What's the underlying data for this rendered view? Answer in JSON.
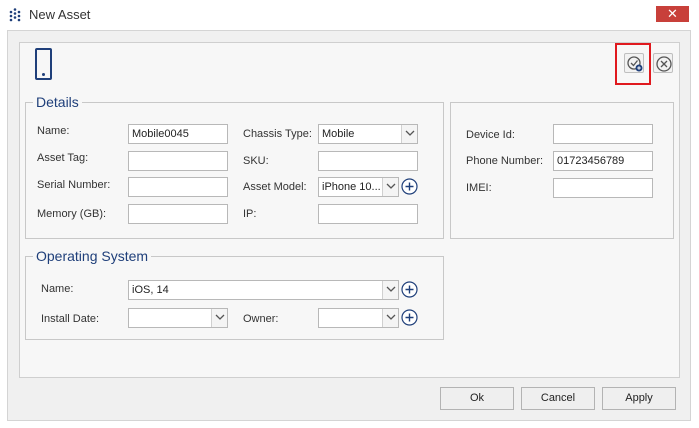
{
  "window": {
    "title": "New Asset",
    "close_glyph": "✕"
  },
  "toolbar": {
    "device_icon": "mobile-phone-icon",
    "save_icon": "save-check-icon",
    "cancel_icon": "close-circle-icon"
  },
  "details": {
    "title": "Details",
    "name": {
      "label": "Name:",
      "value": "Mobile0045"
    },
    "asset_tag": {
      "label": "Asset Tag:",
      "value": ""
    },
    "serial_number": {
      "label": "Serial Number:",
      "value": ""
    },
    "memory": {
      "label": "Memory (GB):",
      "value": ""
    },
    "chassis_type": {
      "label": "Chassis Type:",
      "value": "Mobile"
    },
    "sku": {
      "label": "SKU:",
      "value": ""
    },
    "asset_model": {
      "label": "Asset Model:",
      "value": "iPhone 10..."
    },
    "ip": {
      "label": "IP:",
      "value": ""
    }
  },
  "device": {
    "device_id": {
      "label": "Device Id:",
      "value": ""
    },
    "phone_number": {
      "label": "Phone Number:",
      "value": "01723456789"
    },
    "imei": {
      "label": "IMEI:",
      "value": ""
    }
  },
  "os": {
    "title": "Operating System",
    "name": {
      "label": "Name:",
      "value": "iOS, 14"
    },
    "install_date": {
      "label": "Install Date:",
      "value": ""
    },
    "owner": {
      "label": "Owner:",
      "value": ""
    }
  },
  "footer": {
    "ok": "Ok",
    "cancel": "Cancel",
    "apply": "Apply"
  },
  "colors": {
    "accent": "#1f3f7a",
    "highlight": "#e0191e",
    "close_bg": "#c8403a"
  }
}
